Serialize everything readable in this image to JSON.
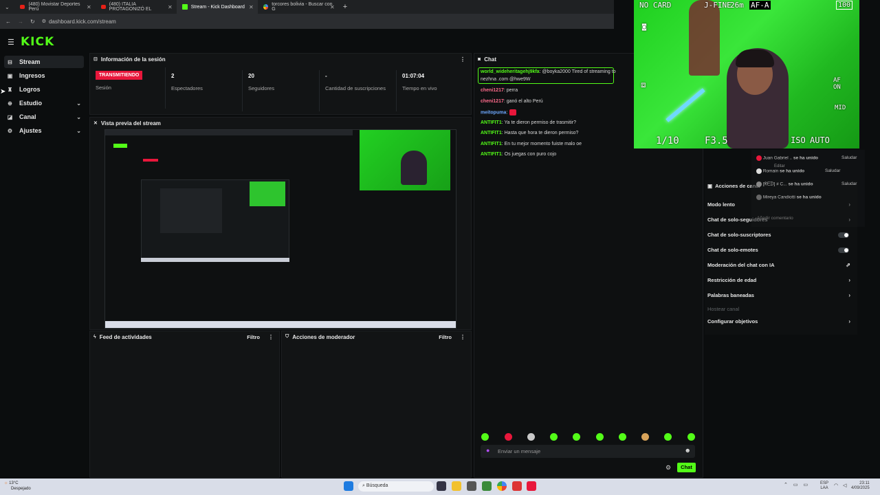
{
  "browser": {
    "tabs": [
      {
        "label": "(480) Movistar Deportes Perú",
        "icon": "youtube-icon"
      },
      {
        "label": "(480) ITALIA PROTAGONIZÓ EL",
        "icon": "youtube-icon"
      },
      {
        "label": "Stream - Kick Dashboard",
        "icon": "kick-icon",
        "active": true
      },
      {
        "label": "torcores bolivia - Buscar con G",
        "icon": "google-icon"
      }
    ],
    "url": "dashboard.kick.com/stream"
  },
  "app": {
    "logo": "KICK"
  },
  "sidebar": {
    "items": [
      {
        "label": "Stream",
        "icon": "stream-icon"
      },
      {
        "label": "Ingresos",
        "icon": "dollar-icon"
      },
      {
        "label": "Logros",
        "icon": "trophy-icon"
      },
      {
        "label": "Estudio",
        "icon": "studio-icon"
      },
      {
        "label": "Canal",
        "icon": "channel-icon"
      },
      {
        "label": "Ajustes",
        "icon": "gear-icon"
      }
    ]
  },
  "session": {
    "title": "Información de la sesión",
    "badge": "TRANSMITIENDO",
    "session_label": "Sesión",
    "stats": [
      {
        "value": "2",
        "label": "Espectadores"
      },
      {
        "value": "20",
        "label": "Seguidores"
      },
      {
        "value": "-",
        "label": "Cantidad de suscripciones"
      },
      {
        "value": "01:07:04",
        "label": "Tiempo en vivo"
      }
    ]
  },
  "preview": {
    "title": "Vista previa del stream"
  },
  "activity": {
    "title": "Feed de actividades",
    "filter": "Filtro"
  },
  "modactions": {
    "title": "Acciones de moderador",
    "filter": "Filtro"
  },
  "chat": {
    "title": "Chat",
    "messages": [
      {
        "user": "world_wideheritagehj9kfa",
        "text": ": @boyka2000 Tired of streaming to",
        "cont": "nezhna .com @hwe9W"
      },
      {
        "user": "cheni1217",
        "text": ": perra"
      },
      {
        "user": "cheni1217",
        "text": ": ganó el alto Perú"
      },
      {
        "user": "meitopuma",
        "text": ":"
      },
      {
        "user": "ANTIFIT1",
        "text": ": Ya te dieron permiso de trasmitir?"
      },
      {
        "user": "ANTIFIT1",
        "text": ": Hasta que hora te dieron permiso?"
      },
      {
        "user": "ANTIFIT1",
        "text": ": En tu mejor momento fuiste malo oe"
      },
      {
        "user": "ANTIFIT1",
        "text": ": Os juegas con puro cojo"
      }
    ],
    "input_placeholder": "Enviar un mensaje",
    "send_label": "Chat"
  },
  "mod_panel": {
    "title": "Acciones de canal",
    "rows": [
      {
        "label": "Modo lento",
        "control": "arrow"
      },
      {
        "label": "Chat de solo-seguidores",
        "control": "arrow"
      },
      {
        "label": "Chat de solo-suscriptores",
        "control": "toggle"
      },
      {
        "label": "Chat de solo-emotes",
        "control": "toggle"
      },
      {
        "label": "Moderación del chat con IA",
        "control": "external"
      },
      {
        "label": "Restricción de edad",
        "control": "arrow"
      },
      {
        "label": "Palabras baneadas",
        "control": "arrow"
      },
      {
        "label": "Hostear canal",
        "control": "none",
        "muted": true
      },
      {
        "label": "Configurar objetivos",
        "control": "arrow"
      }
    ]
  },
  "overlay_notifications": [
    {
      "user": "Juan Gabriel ..",
      "text": "se ha unido",
      "action": "Saludar",
      "sub": "Editar"
    },
    {
      "user": "Romain",
      "text": "se ha unido",
      "action": "Saludar"
    },
    {
      "user": "[ᖇᗴᗪ] ≠ C...",
      "text": "se ha unido",
      "action": "Saludar"
    },
    {
      "user": "Mireya Candiotti",
      "text": "se ha unido"
    }
  ],
  "overlay_comment_placeholder": "Añadir comentario",
  "webcam": {
    "top_left": "NO CARD",
    "top_mid": "J-FINE",
    "top_mid2": "26m",
    "top_right": "AF-A",
    "battery": "100",
    "bottom_left": "1/10",
    "bottom_mid": "F3.5",
    "bottom_iso": "ISO",
    "bottom_auto": "AUTO",
    "side_af": "AF\nON",
    "side_mid": "MID"
  },
  "taskbar": {
    "weather_temp": "13°C",
    "weather_desc": "Despejado",
    "search_label": "Búsqueda",
    "lang": "ESP",
    "lang2": "LAA",
    "time": "23:11",
    "date": "4/09/2025"
  }
}
